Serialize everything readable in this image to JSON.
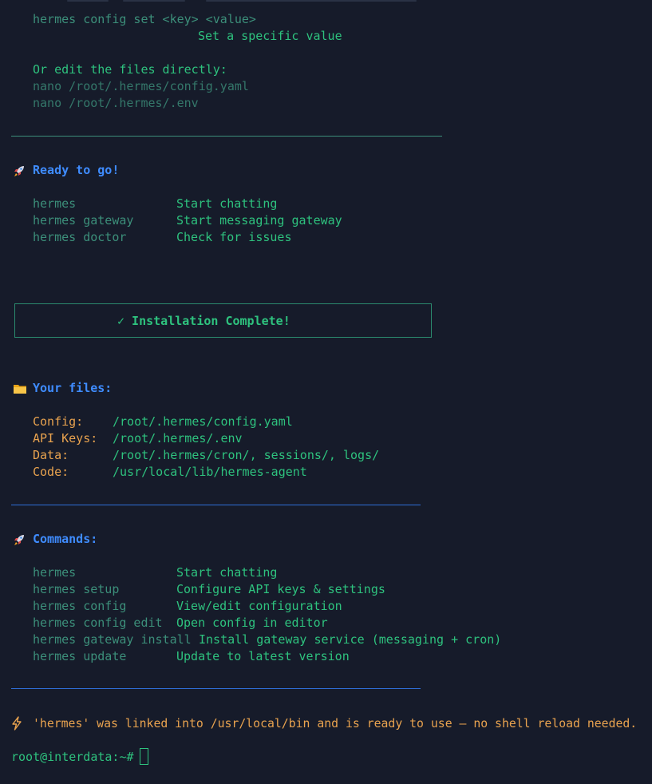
{
  "terminal": {
    "config_set_cmd": "hermes config set <key> <value>",
    "config_set_desc": "Set a specific value",
    "edit_directly_heading": "Or edit the files directly:",
    "edit_file_1": "nano /root/.hermes/config.yaml",
    "edit_file_2": "nano /root/.hermes/.env",
    "ready": {
      "icon": "rocket-icon",
      "title": "Ready to go!",
      "commands": [
        {
          "cmd": "hermes",
          "desc": "Start chatting"
        },
        {
          "cmd": "hermes gateway",
          "desc": "Start messaging gateway"
        },
        {
          "cmd": "hermes doctor",
          "desc": "Check for issues"
        }
      ]
    },
    "install_complete": "✓ Installation Complete!",
    "files": {
      "icon": "folder-icon",
      "title": "Your files:",
      "entries": [
        {
          "label": "Config:",
          "value": "/root/.hermes/config.yaml"
        },
        {
          "label": "API Keys:",
          "value": "/root/.hermes/.env"
        },
        {
          "label": "Data:",
          "value": "/root/.hermes/cron/, sessions/, logs/"
        },
        {
          "label": "Code:",
          "value": "/usr/local/lib/hermes-agent"
        }
      ]
    },
    "commands": {
      "icon": "rocket-icon",
      "title": "Commands:",
      "entries": [
        {
          "cmd": "hermes",
          "desc": "Start chatting"
        },
        {
          "cmd": "hermes setup",
          "desc": "Configure API keys & settings"
        },
        {
          "cmd": "hermes config",
          "desc": "View/edit configuration"
        },
        {
          "cmd": "hermes config edit",
          "desc": "Open config in editor"
        },
        {
          "cmd": "hermes gateway install",
          "desc": "Install gateway service (messaging + cron)"
        },
        {
          "cmd": "hermes update",
          "desc": "Update to latest version"
        }
      ]
    },
    "linked_notice": {
      "icon": "lightning-icon",
      "text": "'hermes' was linked into /usr/local/bin and is ready to use — no shell reload needed."
    },
    "prompt": "root@interdata:~#"
  },
  "colors": {
    "background": "#161b2a",
    "green": "#2ec27e",
    "dim_green": "#3c8f7a",
    "orange": "#e9a34f",
    "blue": "#3f8cff"
  }
}
